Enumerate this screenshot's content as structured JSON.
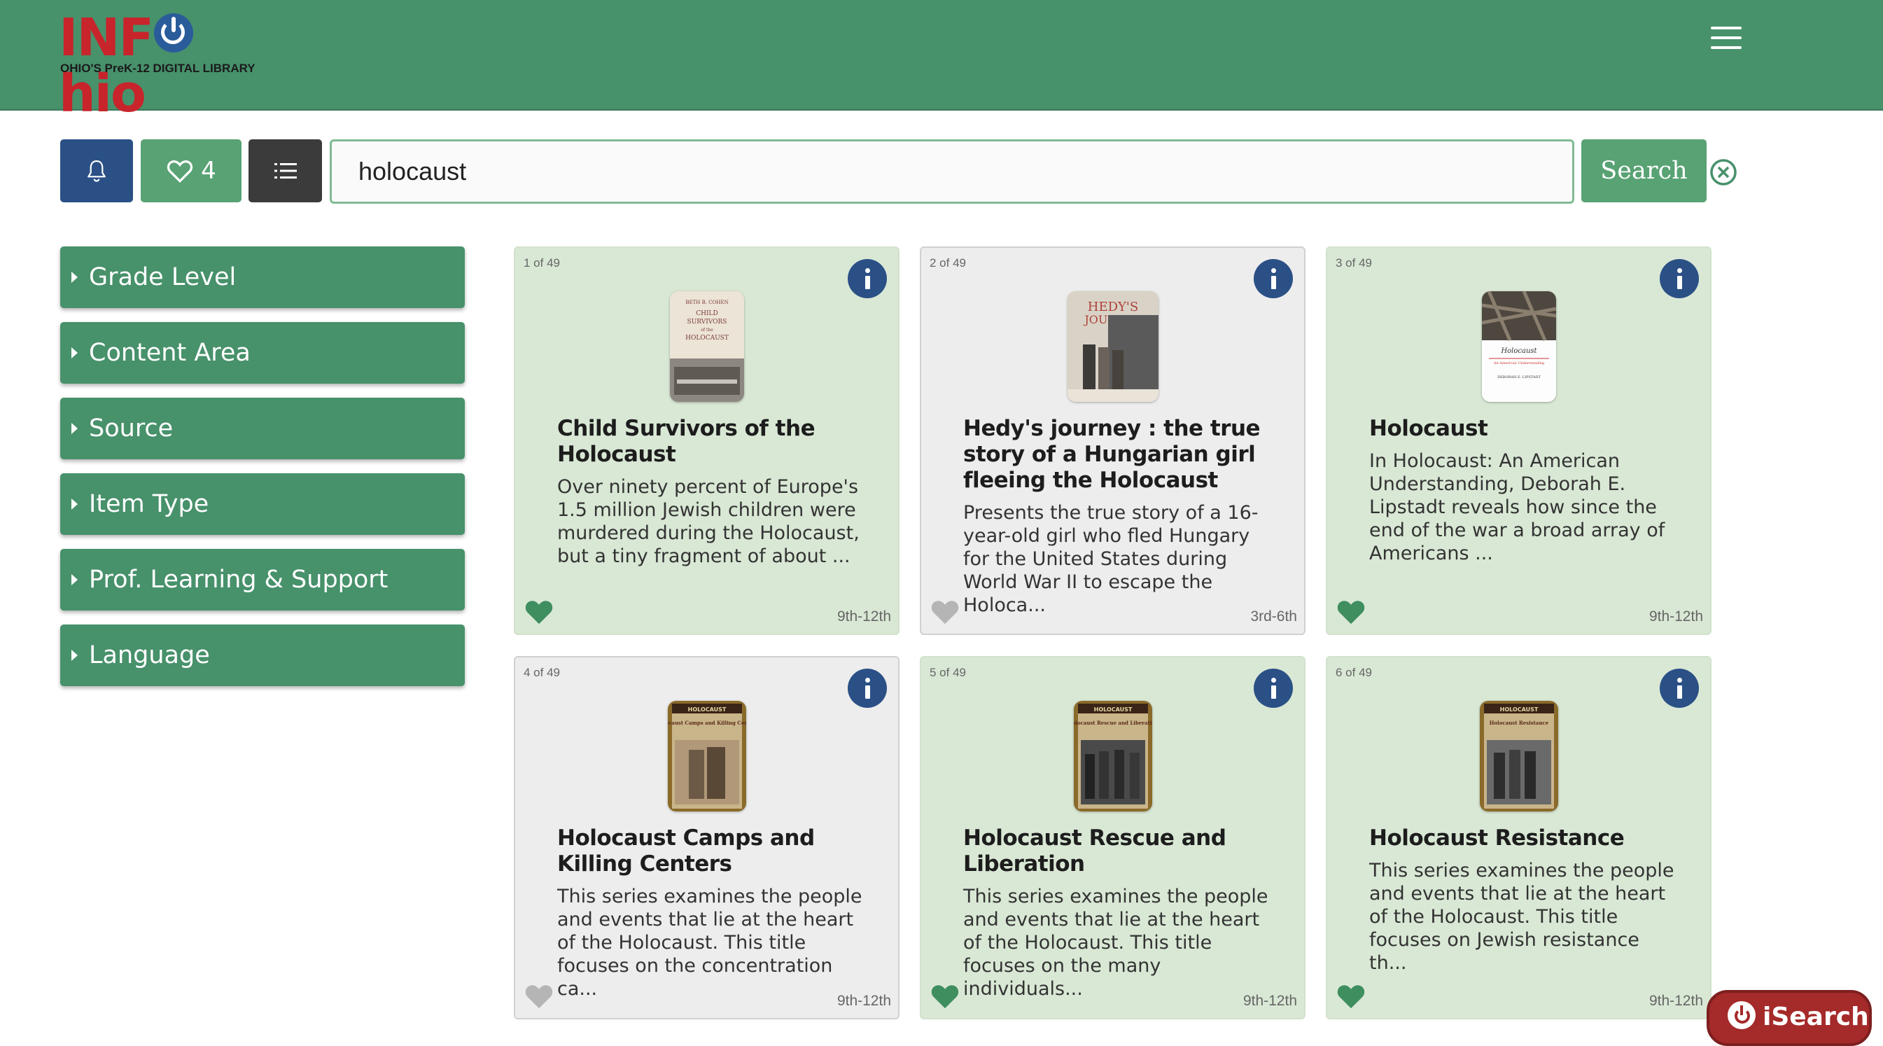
{
  "header": {
    "logo_text_pre": "INF",
    "logo_text_post": "hio",
    "tagline": "OHIO'S PreK-12 DIGITAL LIBRARY"
  },
  "toolbar": {
    "favorites_count": "4",
    "search_value": "holocaust",
    "search_label": "Search"
  },
  "facets": [
    {
      "label": "Grade Level"
    },
    {
      "label": "Content Area"
    },
    {
      "label": "Source"
    },
    {
      "label": "Item Type"
    },
    {
      "label": "Prof. Learning & Support"
    },
    {
      "label": "Language"
    }
  ],
  "results": [
    {
      "count": "1 of 49",
      "title": "Child Survivors of the Holocaust",
      "description": "Over ninety percent of Europe's 1.5 million Jewish children were murdered during the Holocaust, but a tiny fragment of about ...",
      "grade": "9th-12th",
      "favorited": true,
      "style": "green",
      "cover": {
        "title": "CHILD SURVIVORS of the HOLOCAUST",
        "author": "BETH B. COHEN"
      }
    },
    {
      "count": "2 of 49",
      "title": "Hedy's journey : the true story of a Hungarian girl fleeing the Holocaust",
      "description": "Presents the true story of a 16-year-old girl who fled Hungary for the United States during World War II to escape the Holoca...",
      "grade": "3rd-6th",
      "favorited": false,
      "style": "gray",
      "cover": {
        "title": "HEDY'S JOURNEY"
      }
    },
    {
      "count": "3 of 49",
      "title": "Holocaust",
      "description": "In Holocaust: An American Understanding, Deborah E. Lipstadt reveals how since the end of the war a broad array of Americans ...",
      "grade": "9th-12th",
      "favorited": true,
      "style": "green",
      "cover": {
        "title": "Holocaust",
        "subtitle": "An American Understanding",
        "author": "DEBORAH E. LIPSTADT"
      }
    },
    {
      "count": "4 of 49",
      "title": "Holocaust Camps and Killing Centers",
      "description": "This series examines the people and events that lie at the heart of the Holocaust. This title focuses on the concentration ca...",
      "grade": "9th-12th",
      "favorited": false,
      "style": "gray",
      "cover": {
        "series": "HOLOCAUST",
        "title": "Holocaust Camps and Killing Centers"
      }
    },
    {
      "count": "5 of 49",
      "title": "Holocaust Rescue and Liberation",
      "description": "This series examines the people and events that lie at the heart of the Holocaust. This title focuses on the many individuals...",
      "grade": "9th-12th",
      "favorited": true,
      "style": "green",
      "cover": {
        "series": "HOLOCAUST",
        "title": "Holocaust Rescue and Liberation"
      }
    },
    {
      "count": "6 of 49",
      "title": "Holocaust Resistance",
      "description": "This series examines the people and events that lie at the heart of the Holocaust. This title focuses on Jewish resistance th...",
      "grade": "9th-12th",
      "favorited": true,
      "style": "green",
      "cover": {
        "series": "HOLOCAUST",
        "title": "Holocaust Resistance"
      }
    }
  ],
  "isearch": {
    "label": "iSearch"
  },
  "colors": {
    "header_green": "#47916b",
    "button_green": "#58a274",
    "navy": "#2a5086",
    "card_green": "#d9e8d5",
    "card_gray": "#ededed",
    "heart_active": "#3e8e5f",
    "heart_inactive": "#b5b5b5",
    "logo_red": "#c8242b"
  },
  "icons": {
    "notifications": "bell-icon",
    "favorites": "heart-icon",
    "list": "list-icon",
    "clear": "close-circle-icon",
    "info": "info-icon",
    "menu": "hamburger-icon",
    "facet": "caret-right-icon"
  }
}
